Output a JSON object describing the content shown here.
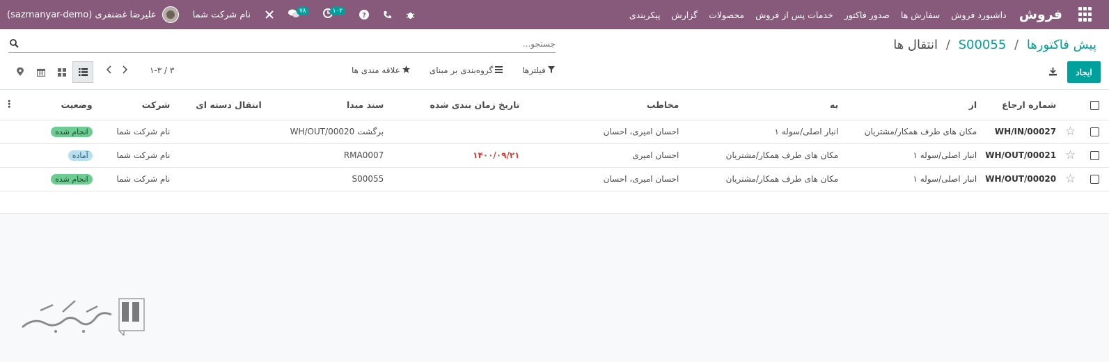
{
  "header": {
    "brand": "فروش",
    "menu": [
      "داشبورد فروش",
      "سفارش ها",
      "صدور فاکتور",
      "خدمات پس از فروش",
      "محصولات",
      "گزارش",
      "پیکربندی"
    ],
    "company": "نام شرکت شما",
    "user": "علیرضا غضنفری (sazmanyar-demo)",
    "badge_activities": "۱۰۲",
    "badge_messages": "۷۸"
  },
  "breadcrumb": {
    "first": "پیش فاکتورها",
    "second": "S00055",
    "current": "انتقال ها"
  },
  "search": {
    "placeholder": "جستجو..."
  },
  "toolbar": {
    "create": "ایجاد",
    "filters": "فیلترها",
    "groupby": "گروه‌بندی بر مبنای",
    "favorites": "علاقه مندی ها",
    "pager": "۱-۳ / ۳"
  },
  "table": {
    "headers": {
      "ref": "شماره ارجاع",
      "from": "از",
      "to": "به",
      "contact": "مخاطب",
      "scheduled": "تاریخ زمان بندی شده",
      "source": "سند مبدا",
      "batch": "انتقال دسته ای",
      "company": "شرکت",
      "state": "وضعیت"
    },
    "rows": [
      {
        "ref": "WH/IN/00027",
        "from": "مکان های طرف همکار/مشتریان",
        "to": "انبار اصلی/سوله ۱",
        "contact": "احسان امیری، احسان",
        "scheduled": "",
        "source": "برگشت WH/OUT/00020",
        "batch": "",
        "company": "نام شرکت شما",
        "state": "انجام شده"
      },
      {
        "ref": "WH/OUT/00021",
        "from": "انبار اصلی/سوله ۱",
        "to": "مکان های طرف همکار/مشتریان",
        "contact": "احسان امیری",
        "scheduled": "۱۴۰۰/۰۹/۲۱",
        "source": "RMA0007",
        "batch": "",
        "company": "نام شرکت شما",
        "state": "آماده"
      },
      {
        "ref": "WH/OUT/00020",
        "from": "انبار اصلی/سوله ۱",
        "to": "مکان های طرف همکار/مشتریان",
        "contact": "احسان امیری، احسان",
        "scheduled": "",
        "source": "S00055",
        "batch": "",
        "company": "نام شرکت شما",
        "state": "انجام شده"
      }
    ]
  },
  "colors": {
    "brand": "#875a7b",
    "accent": "#00a09d",
    "done": "#6dcc92",
    "ready": "#b8dff0",
    "late": "#d23f3a"
  }
}
